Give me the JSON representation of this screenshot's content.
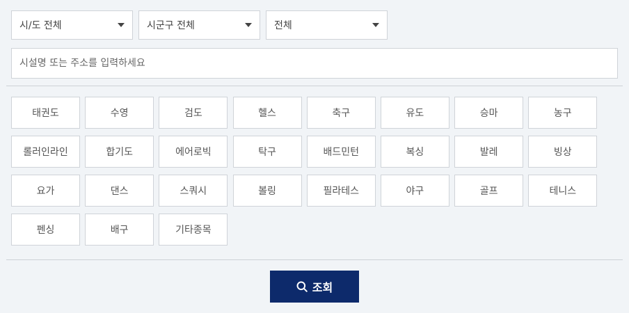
{
  "filters": {
    "sido": {
      "selected": "시/도 전체"
    },
    "sigungu": {
      "selected": "시군구 전체"
    },
    "type": {
      "selected": "전체"
    }
  },
  "search": {
    "placeholder": "시설명 또는 주소를 입력하세요",
    "value": ""
  },
  "sports": [
    "태권도",
    "수영",
    "검도",
    "헬스",
    "축구",
    "유도",
    "승마",
    "농구",
    "롤러인라인",
    "합기도",
    "에어로빅",
    "탁구",
    "배드민턴",
    "복싱",
    "발레",
    "빙상",
    "요가",
    "댄스",
    "스쿼시",
    "볼링",
    "필라테스",
    "야구",
    "골프",
    "테니스",
    "펜싱",
    "배구",
    "기타종목"
  ],
  "submit": {
    "label": "조회",
    "icon": "search-icon"
  },
  "colors": {
    "background": "#f1f4f7",
    "button": "#0d2a6b",
    "border": "#cfd3d8"
  }
}
